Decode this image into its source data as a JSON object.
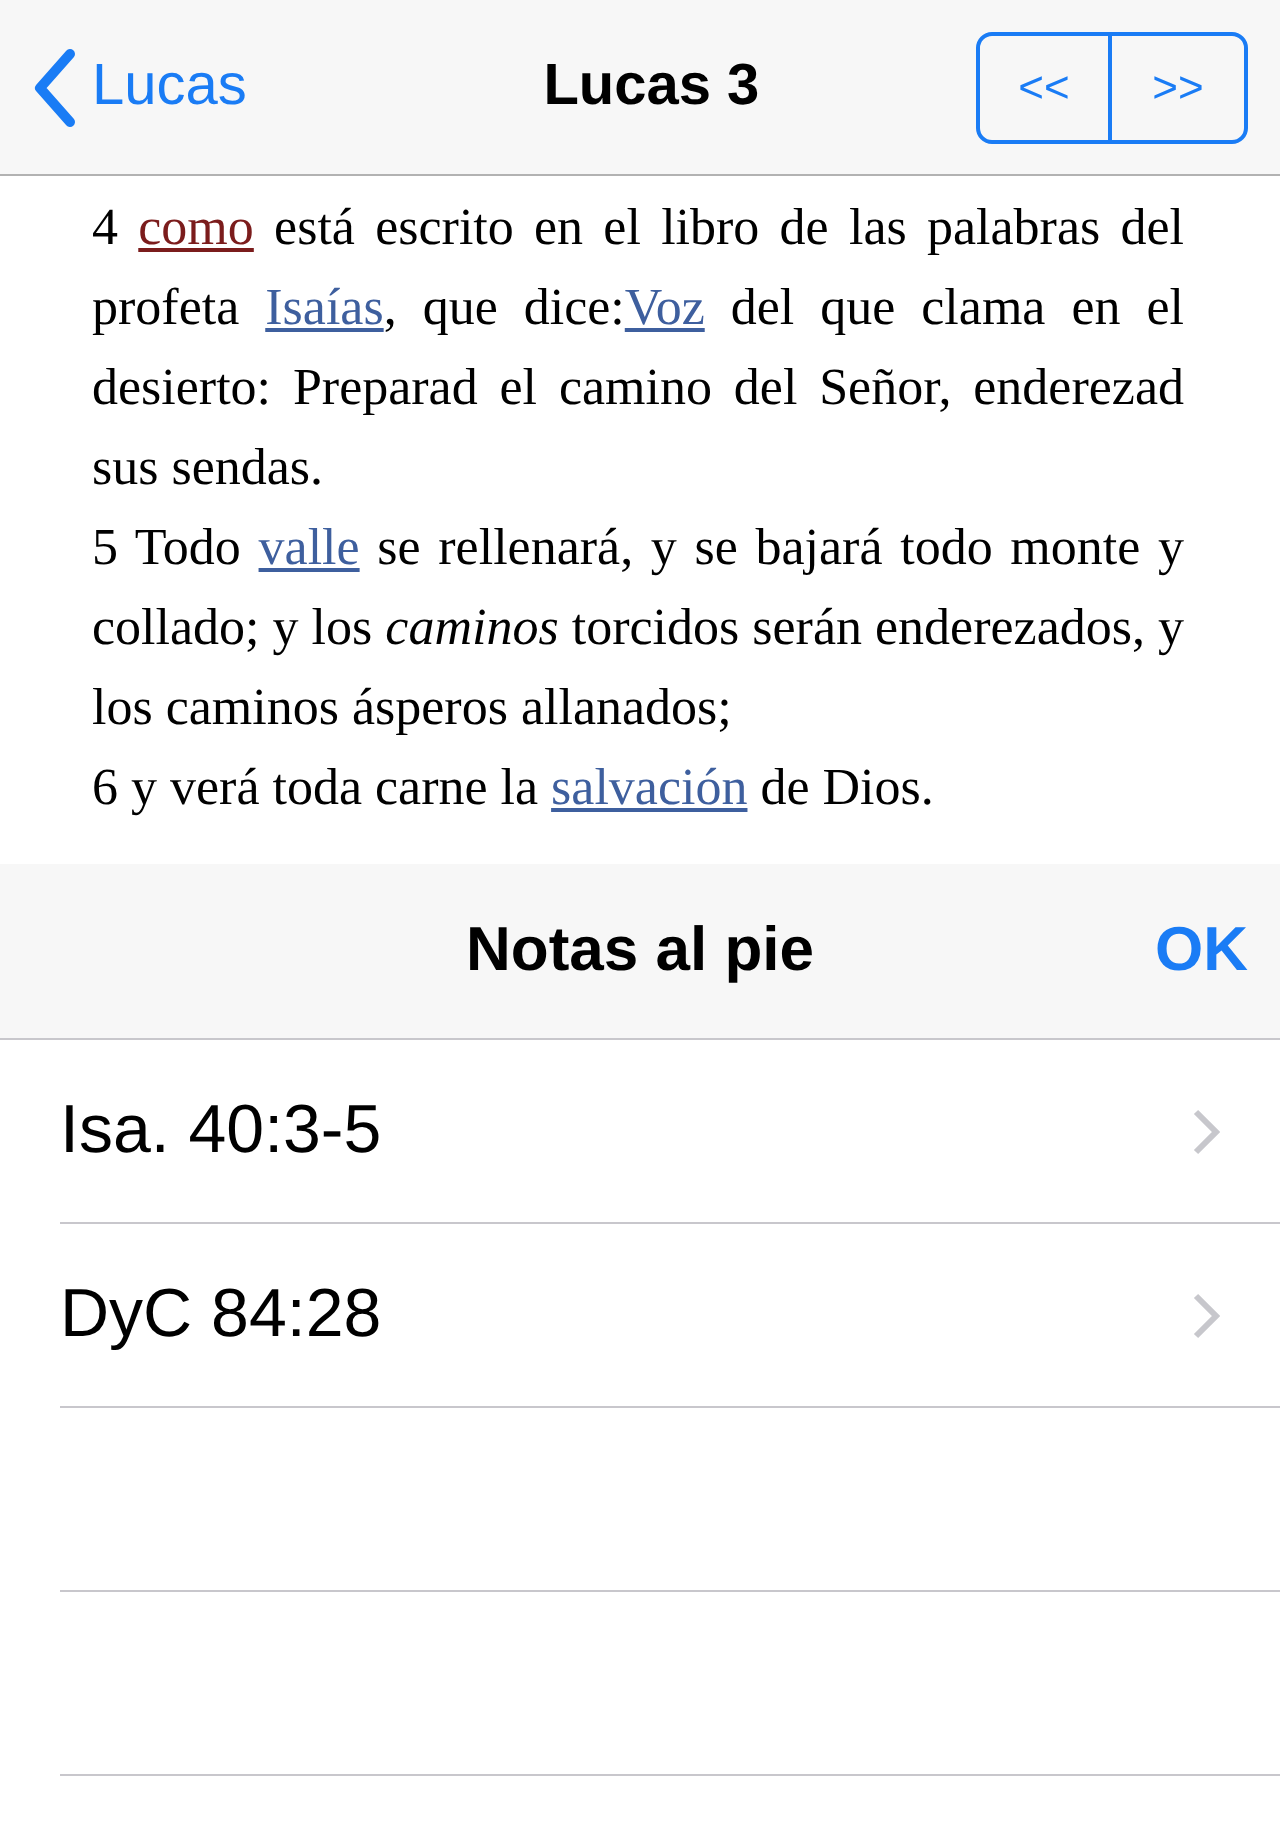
{
  "nav_bar": {
    "back_label": "Lucas",
    "title": "Lucas 3",
    "prev_label": "<<",
    "next_label": ">>"
  },
  "verses": [
    {
      "segments": [
        {
          "kind": "text",
          "text": "4 "
        },
        {
          "kind": "ref",
          "text": "como"
        },
        {
          "kind": "text",
          "text": " está escrito en el libro de las palabras del profeta "
        },
        {
          "kind": "link",
          "text": "Isaías"
        },
        {
          "kind": "text",
          "text": ", que dice:"
        },
        {
          "kind": "link",
          "text": "Voz"
        },
        {
          "kind": "text",
          "text": " del que clama en el desierto: Preparad el camino del Señor, enderezad sus sendas."
        }
      ]
    },
    {
      "segments": [
        {
          "kind": "text",
          "text": "5 Todo "
        },
        {
          "kind": "link",
          "text": "valle"
        },
        {
          "kind": "text",
          "text": " se rellenará, y se bajará todo monte y collado; y los "
        },
        {
          "kind": "italic",
          "text": "caminos"
        },
        {
          "kind": "text",
          "text": " torcidos serán enderezados, y los caminos ásperos allanados;"
        }
      ]
    },
    {
      "segments": [
        {
          "kind": "text",
          "text": "6 y verá toda carne la "
        },
        {
          "kind": "link",
          "text": "salvación"
        },
        {
          "kind": "text",
          "text": " de Dios."
        }
      ]
    }
  ],
  "footnotes_sheet": {
    "title": "Notas al pie",
    "done_label": "OK",
    "items": [
      {
        "label": "Isa. 40:3-5"
      },
      {
        "label": "DyC 84:28"
      }
    ]
  }
}
